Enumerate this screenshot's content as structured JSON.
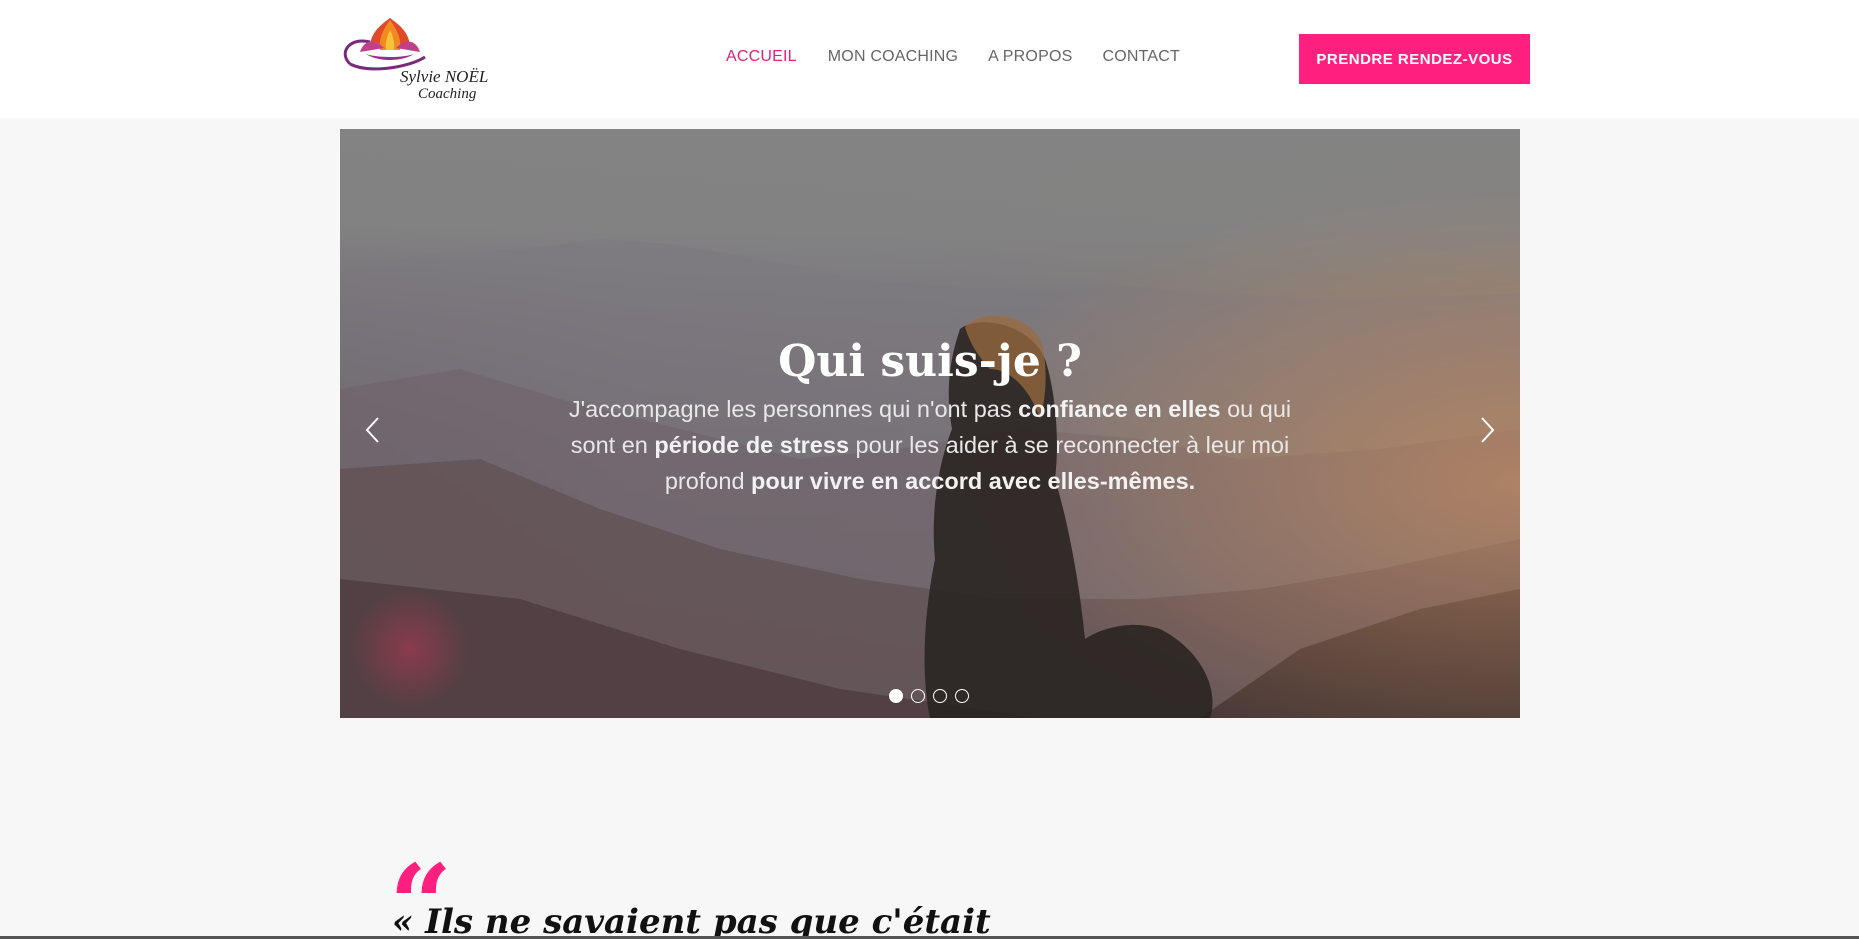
{
  "header": {
    "logo": {
      "name": "Sylvie NOËL",
      "subtitle": "Coaching",
      "icon": "lotus-icon"
    },
    "nav": [
      {
        "label": "ACCUEIL",
        "active": true
      },
      {
        "label": "MON COACHING",
        "active": false
      },
      {
        "label": "A PROPOS",
        "active": false
      },
      {
        "label": "CONTACT",
        "active": false
      }
    ],
    "cta_label": "PRENDRE RENDEZ-VOUS"
  },
  "hero": {
    "title": "Qui suis-je ?",
    "text_parts": [
      "J'accompagne les personnes qui n'ont pas ",
      "confiance en elles",
      " ou qui sont en ",
      "période de stress",
      " pour les aider à se reconnecter à leur moi profond ",
      "pour vivre en accord avec elles-mêmes."
    ],
    "slide_count": 4,
    "active_slide": 1,
    "prev_icon": "chevron-left-icon",
    "next_icon": "chevron-right-icon"
  },
  "quote": {
    "text": "« Ils ne savaient pas que c'était"
  },
  "colors": {
    "accent": "#ff1f7f",
    "nav_active": "#e6207a",
    "nav_text": "#666666",
    "background": "#f7f7f7"
  }
}
